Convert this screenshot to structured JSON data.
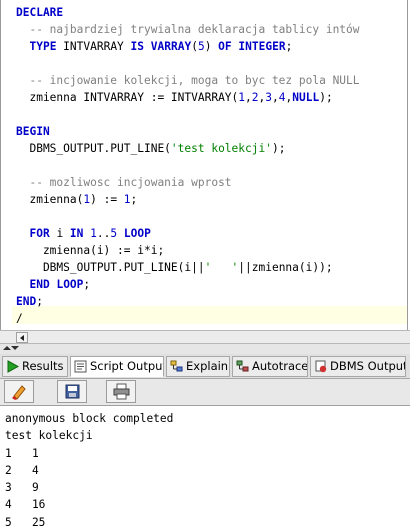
{
  "editor": {
    "lines": [
      [
        {
          "t": "DECLARE",
          "c": "kw"
        }
      ],
      [
        {
          "t": "  -- najbardziej trywialna deklaracja tablicy intów",
          "c": "cm"
        }
      ],
      [
        {
          "t": "  "
        },
        {
          "t": "TYPE",
          "c": "kw"
        },
        {
          "t": " INTVARRAY "
        },
        {
          "t": "IS",
          "c": "kw"
        },
        {
          "t": " "
        },
        {
          "t": "VARRAY",
          "c": "kw"
        },
        {
          "t": "("
        },
        {
          "t": "5",
          "c": "nm"
        },
        {
          "t": ") "
        },
        {
          "t": "OF",
          "c": "kw"
        },
        {
          "t": " "
        },
        {
          "t": "INTEGER",
          "c": "kw"
        },
        {
          "t": ";"
        }
      ],
      [
        {
          "t": ""
        }
      ],
      [
        {
          "t": "  -- incjowanie kolekcji, moga to byc tez pola NULL",
          "c": "cm"
        }
      ],
      [
        {
          "t": "  zmienna INTVARRAY := INTVARRAY("
        },
        {
          "t": "1",
          "c": "nm"
        },
        {
          "t": ","
        },
        {
          "t": "2",
          "c": "nm"
        },
        {
          "t": ","
        },
        {
          "t": "3",
          "c": "nm"
        },
        {
          "t": ","
        },
        {
          "t": "4",
          "c": "nm"
        },
        {
          "t": ","
        },
        {
          "t": "NULL",
          "c": "kw"
        },
        {
          "t": ");"
        }
      ],
      [
        {
          "t": ""
        }
      ],
      [
        {
          "t": "BEGIN",
          "c": "kw"
        }
      ],
      [
        {
          "t": "  DBMS_OUTPUT.PUT_LINE("
        },
        {
          "t": "'test kolekcji'",
          "c": "st"
        },
        {
          "t": ");"
        }
      ],
      [
        {
          "t": ""
        }
      ],
      [
        {
          "t": "  -- mozliwosc incjowania wprost",
          "c": "cm"
        }
      ],
      [
        {
          "t": "  zmienna("
        },
        {
          "t": "1",
          "c": "nm"
        },
        {
          "t": ") := "
        },
        {
          "t": "1",
          "c": "nm"
        },
        {
          "t": ";"
        }
      ],
      [
        {
          "t": ""
        }
      ],
      [
        {
          "t": "  "
        },
        {
          "t": "FOR",
          "c": "kw"
        },
        {
          "t": " i "
        },
        {
          "t": "IN",
          "c": "kw"
        },
        {
          "t": " "
        },
        {
          "t": "1",
          "c": "nm"
        },
        {
          "t": ".."
        },
        {
          "t": "5",
          "c": "nm"
        },
        {
          "t": " "
        },
        {
          "t": "LOOP",
          "c": "kw"
        }
      ],
      [
        {
          "t": "    zmienna(i) := i*i;"
        }
      ],
      [
        {
          "t": "    DBMS_OUTPUT.PUT_LINE(i||"
        },
        {
          "t": "'   '",
          "c": "st"
        },
        {
          "t": "||zmienna(i));"
        }
      ],
      [
        {
          "t": "  "
        },
        {
          "t": "END",
          "c": "kw"
        },
        {
          "t": " "
        },
        {
          "t": "LOOP",
          "c": "kw"
        },
        {
          "t": ";"
        }
      ],
      [
        {
          "t": "END",
          "c": "kw"
        },
        {
          "t": ";"
        }
      ],
      [
        {
          "t": "/"
        }
      ]
    ]
  },
  "tabs": [
    {
      "label": "Results",
      "icon": "run-icon"
    },
    {
      "label": "Script Output",
      "icon": "script-output-icon",
      "active": true
    },
    {
      "label": "Explain",
      "icon": "explain-plan-icon"
    },
    {
      "label": "Autotrace",
      "icon": "autotrace-icon"
    },
    {
      "label": "DBMS Output",
      "icon": "dbms-output-icon"
    }
  ],
  "toolbar": {
    "buttons": [
      {
        "name": "clear-output-button",
        "icon": "eraser-icon"
      },
      {
        "name": "save-output-button",
        "icon": "save-icon"
      },
      {
        "name": "print-output-button",
        "icon": "printer-icon"
      }
    ]
  },
  "output": {
    "lines": [
      "anonymous block completed",
      "test kolekcji",
      "1   1",
      "2   4",
      "3   9",
      "4   16",
      "5   25"
    ]
  },
  "colors": {
    "keyword": "#0000c8",
    "comment": "#808080",
    "string": "#008000",
    "current_line": "#ffffe4"
  }
}
